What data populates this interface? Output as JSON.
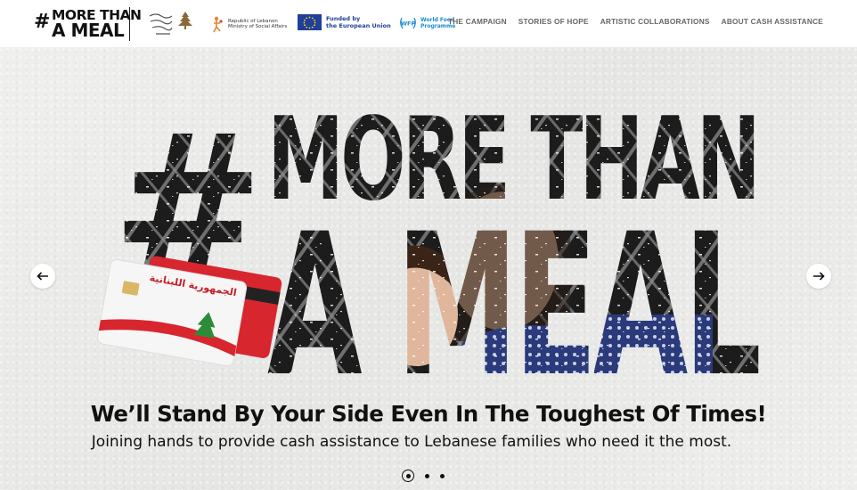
{
  "brand": {
    "hash": "#",
    "line1": "MORE THAN",
    "line2": "A MEAL"
  },
  "partners": {
    "mosa": {
      "line1": "Republic of Lebanon",
      "line2": "Ministry of Social Affairs"
    },
    "eu": {
      "line1": "Funded by",
      "line2": "the European Union"
    },
    "wfp": {
      "badge": "WFP",
      "line1": "World Food",
      "line2": "Programme"
    }
  },
  "nav": {
    "items": [
      {
        "label": "THE CAMPAIGN"
      },
      {
        "label": "STORIES OF HOPE"
      },
      {
        "label": "ARTISTIC COLLABORATIONS"
      },
      {
        "label": "ABOUT CASH ASSISTANCE"
      }
    ]
  },
  "hero": {
    "art_line1": "MORE THAN",
    "art_line2": "A MEAL",
    "card_text": "الجمهورية اللبنانية",
    "heading": "We’ll Stand By Your Side Even In The Toughest Of Times!",
    "subheading": "Joining hands to provide cash assistance to Lebanese families who need it the most.",
    "slides_total": 3,
    "slide_active": 1
  },
  "icons": {
    "prev": "arrow-left-icon",
    "next": "arrow-right-icon"
  },
  "colors": {
    "eu_blue": "#1f3f9a",
    "wfp_blue": "#1a8ccf",
    "card_red": "#d8262f",
    "cedar_green": "#2e8b3a",
    "nav_gray": "#666666"
  }
}
